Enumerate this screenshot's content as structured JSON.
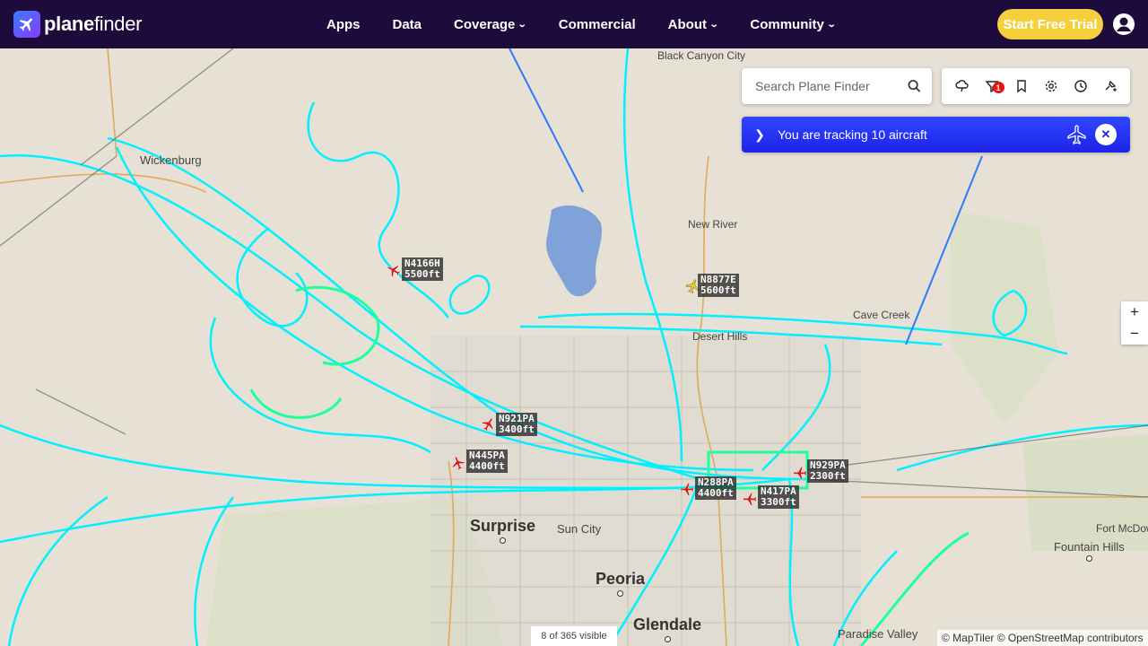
{
  "brand": {
    "name_bold": "plane",
    "name_rest": "finder"
  },
  "nav": [
    {
      "label": "Apps",
      "dropdown": false
    },
    {
      "label": "Data",
      "dropdown": false
    },
    {
      "label": "Coverage",
      "dropdown": true
    },
    {
      "label": "Commercial",
      "dropdown": false
    },
    {
      "label": "About",
      "dropdown": true
    },
    {
      "label": "Community",
      "dropdown": true
    }
  ],
  "cta": {
    "label": "Start Free Trial"
  },
  "search": {
    "placeholder": "Search Plane Finder"
  },
  "tools": {
    "filter_badge": "1"
  },
  "tracking": {
    "text": "You are tracking 10 aircraft"
  },
  "places": [
    {
      "name": "Black Canyon City",
      "size": "small"
    },
    {
      "name": "Wickenburg",
      "size": "med"
    },
    {
      "name": "New River",
      "size": "small"
    },
    {
      "name": "Cave Creek",
      "size": "small"
    },
    {
      "name": "Desert Hills",
      "size": "small"
    },
    {
      "name": "Surprise",
      "size": "big"
    },
    {
      "name": "Sun City",
      "size": "med"
    },
    {
      "name": "Peoria",
      "size": "big"
    },
    {
      "name": "Glendale",
      "size": "big"
    },
    {
      "name": "Paradise Valley",
      "size": "med"
    },
    {
      "name": "Fountain Hills",
      "size": "med"
    },
    {
      "name": "Fort McDowell",
      "size": "small"
    }
  ],
  "aircraft": [
    {
      "reg": "N4166H",
      "alt": "5500ft"
    },
    {
      "reg": "N8877E",
      "alt": "5600ft"
    },
    {
      "reg": "N921PA",
      "alt": "3400ft"
    },
    {
      "reg": "N445PA",
      "alt": "4400ft"
    },
    {
      "reg": "N288PA",
      "alt": "4400ft"
    },
    {
      "reg": "N417PA",
      "alt": "3300ft"
    },
    {
      "reg": "N929PA",
      "alt": "2300ft"
    }
  ],
  "map": {
    "visible_count": "8 of 365 visible",
    "attribution": "© MapTiler © OpenStreetMap contributors",
    "zoom_in": "+",
    "zoom_out": "−"
  },
  "colors": {
    "header": "#1c0b3b",
    "track": "#00f0ff",
    "track_low": "#1fff9a",
    "cta": "#f6cf3c",
    "tracking_bar": "#1e22e8",
    "aircraft": "#d41c1c"
  }
}
